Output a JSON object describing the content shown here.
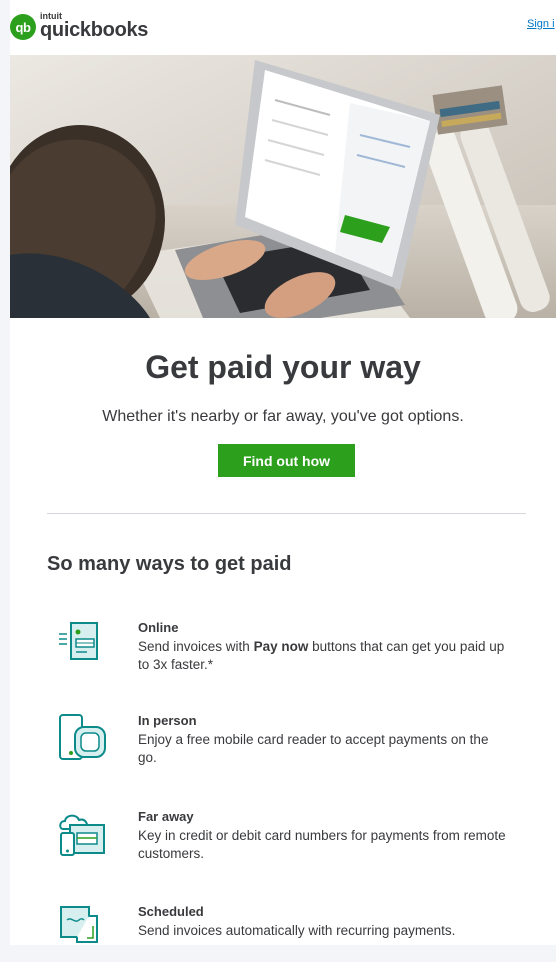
{
  "header": {
    "logo_mark": "qb",
    "logo_intuit": "intuit",
    "logo_word": "quickbooks",
    "signin_label": "Sign i"
  },
  "hero": {
    "image": "person-typing-on-laptop"
  },
  "main": {
    "headline": "Get paid your way",
    "subline": "Whether it's nearby or far away, you've got options.",
    "cta_label": "Find out how"
  },
  "ways": {
    "title": "So many ways to get paid",
    "items": [
      {
        "icon": "invoice-online-icon",
        "title": "Online",
        "desc_before": "Send invoices with ",
        "desc_bold": "Pay now",
        "desc_after": " buttons that can get you paid up to 3x faster.*"
      },
      {
        "icon": "card-reader-icon",
        "title": "In person",
        "desc": "Enjoy a free mobile card reader to accept payments on the go."
      },
      {
        "icon": "remote-payment-icon",
        "title": "Far away",
        "desc": "Key in credit or debit card numbers for payments from remote customers."
      },
      {
        "icon": "scheduled-invoice-icon",
        "title": "Scheduled",
        "desc": "Send invoices automatically with recurring payments."
      }
    ]
  },
  "colors": {
    "brand_green": "#2ca01c",
    "link_blue": "#0077c5",
    "text": "#393a3d",
    "icon_teal": "#0d8a8a",
    "icon_fill": "#d7f0ef"
  }
}
